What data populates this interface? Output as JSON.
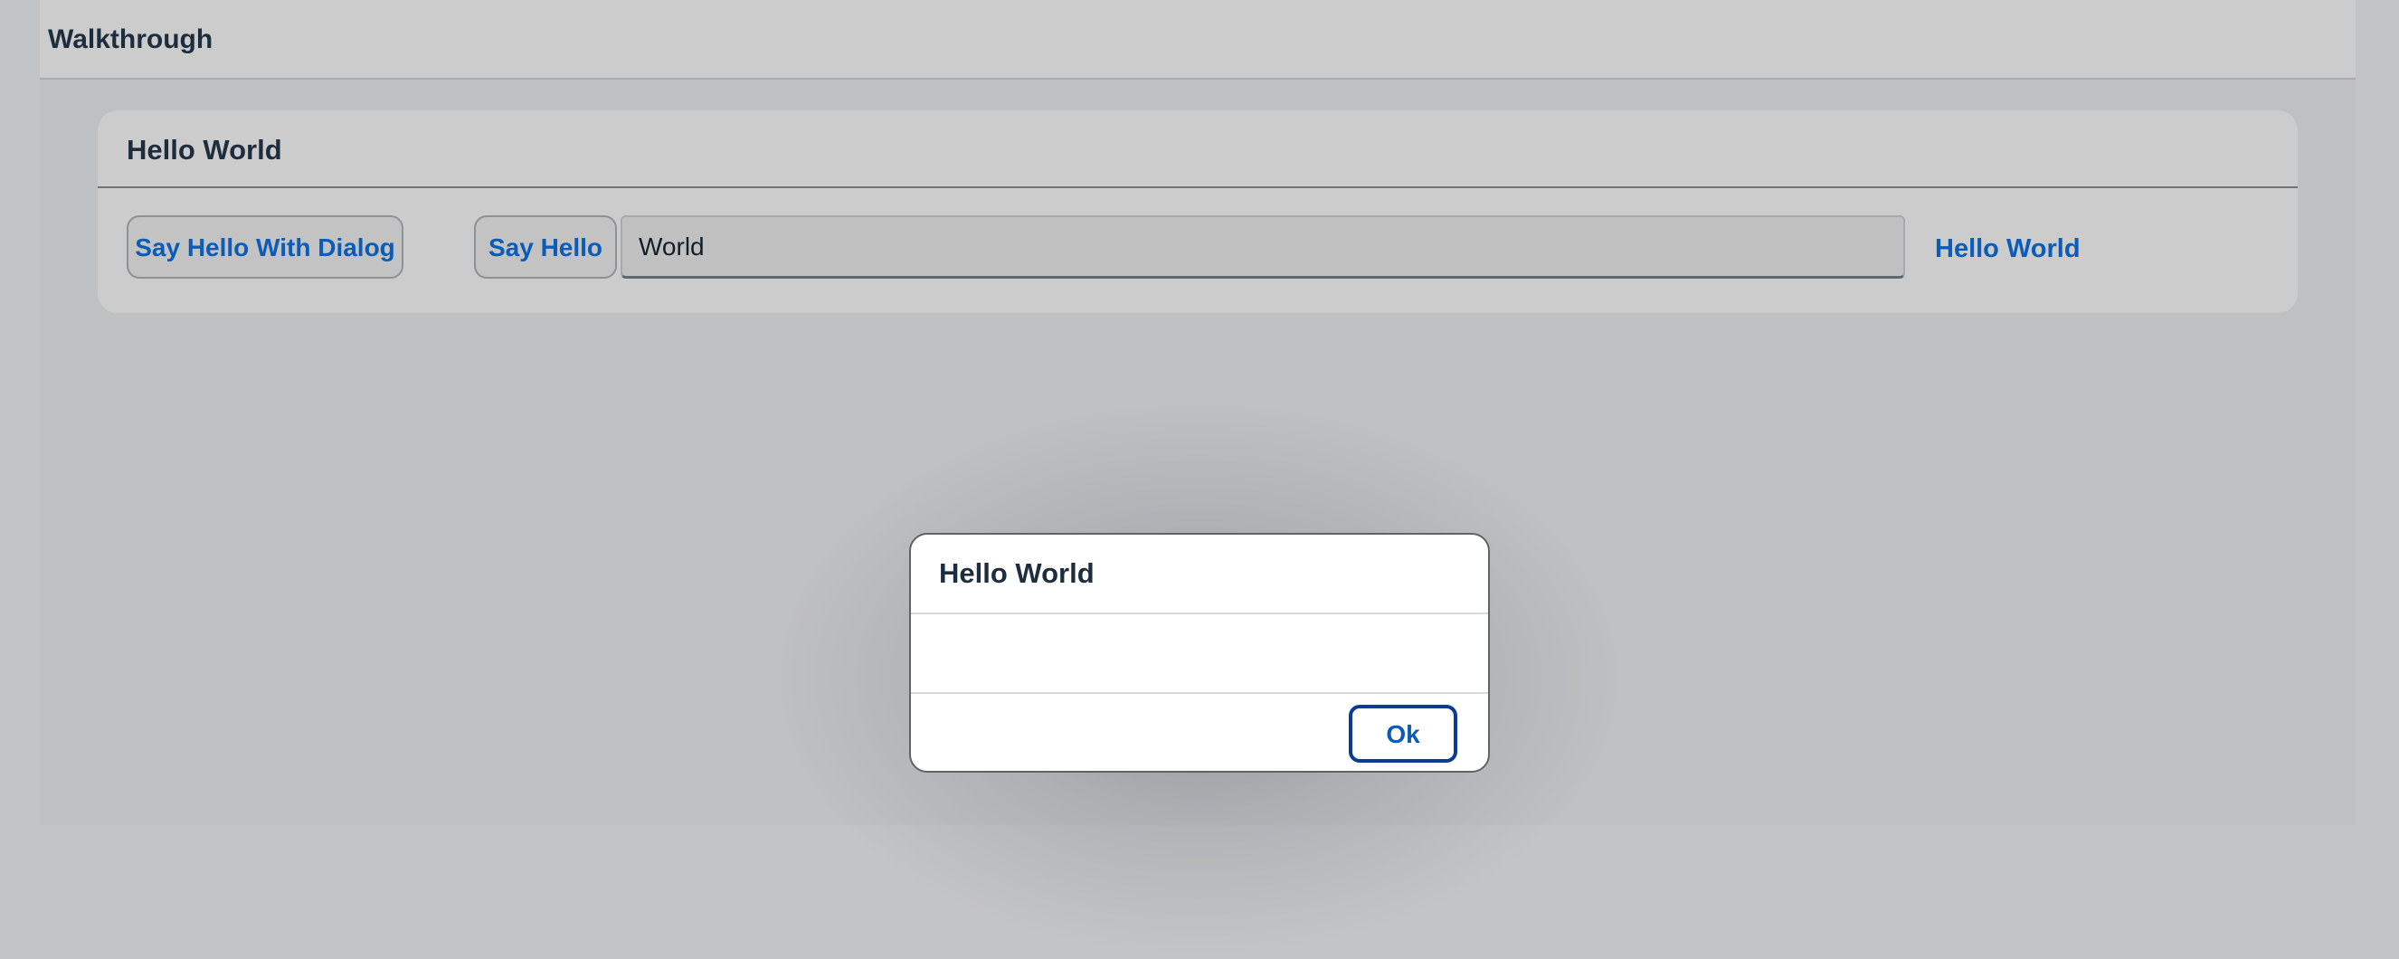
{
  "page": {
    "title": "Walkthrough"
  },
  "panel": {
    "title": "Hello World",
    "say_hello_dialog_label": "Say Hello With Dialog",
    "say_hello_label": "Say Hello",
    "name_input_value": "World",
    "output_text": "Hello World"
  },
  "dialog": {
    "title": "Hello World",
    "ok_label": "Ok"
  },
  "colors": {
    "accent": "#0b5bb8",
    "title_text": "#1d2d3e",
    "backdrop": "#c3c4c6",
    "dialog_background": "#ffffff"
  }
}
